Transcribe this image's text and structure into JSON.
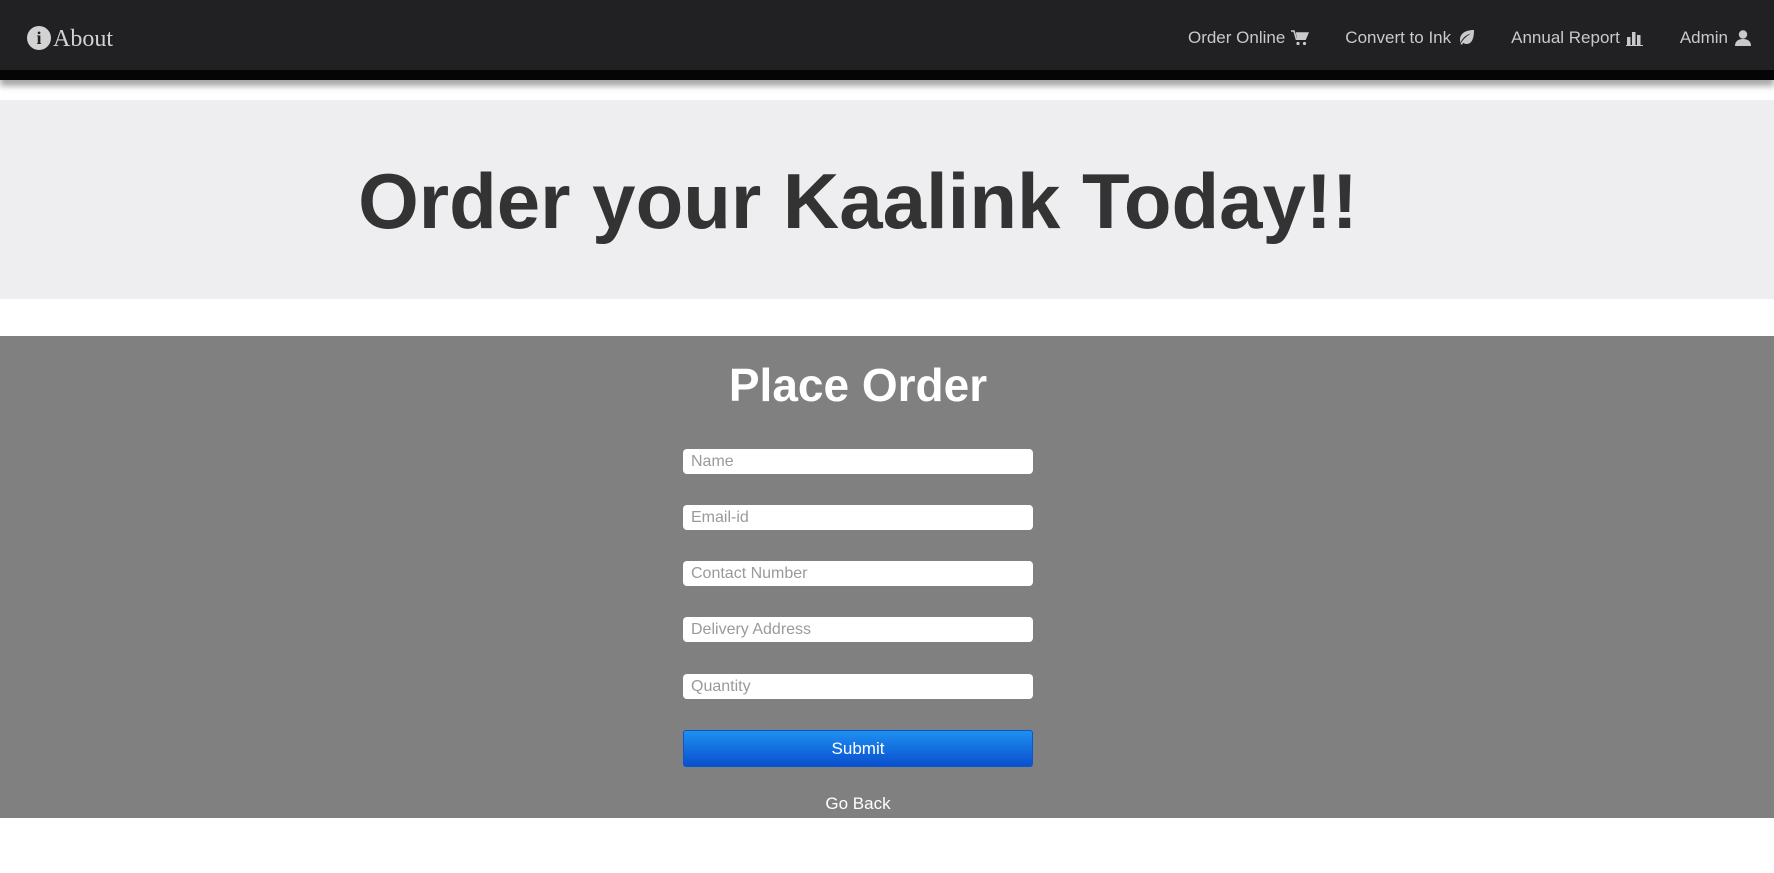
{
  "navbar": {
    "brand_icon": "info-circle-icon",
    "brand_icon_glyph": "i",
    "brand_label": "About",
    "links": [
      {
        "label": "Order Online",
        "icon": "cart-icon"
      },
      {
        "label": "Convert to Ink",
        "icon": "leaf-icon"
      },
      {
        "label": "Annual Report",
        "icon": "bar-chart-icon"
      },
      {
        "label": "Admin",
        "icon": "user-icon"
      }
    ]
  },
  "hero": {
    "title": "Order your Kaalink Today!!"
  },
  "order_form": {
    "heading": "Place Order",
    "fields": [
      {
        "placeholder": "Name",
        "value": ""
      },
      {
        "placeholder": "Email-id",
        "value": ""
      },
      {
        "placeholder": "Contact Number",
        "value": ""
      },
      {
        "placeholder": "Delivery Address",
        "value": ""
      },
      {
        "placeholder": "Quantity",
        "value": ""
      }
    ],
    "submit_label": "Submit",
    "back_label": "Go Back"
  },
  "colors": {
    "navbar_bg": "#212023",
    "hero_bg": "#eeeef0",
    "panel_bg": "#808080",
    "submit_bg": "#0a4fcf",
    "text_dark": "#333333"
  }
}
